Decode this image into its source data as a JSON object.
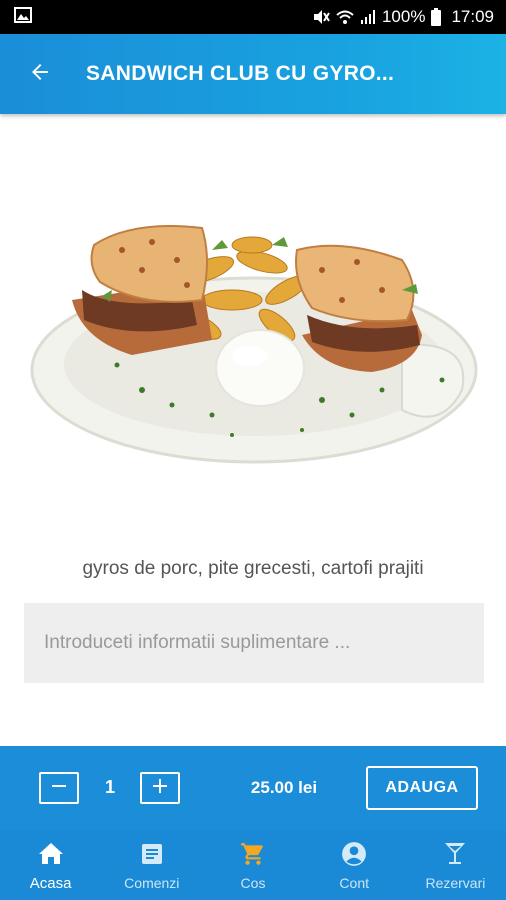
{
  "status_bar": {
    "battery": "100%",
    "time": "17:09"
  },
  "app_bar": {
    "title": "SANDWICH CLUB CU GYRO..."
  },
  "product": {
    "image_icon": "gyros-sandwich-plate",
    "description": "gyros de porc, pite grecesti, cartofi prajiti"
  },
  "notes": {
    "value": "",
    "placeholder": "Introduceti informatii suplimentare ..."
  },
  "order": {
    "minus_label": "−",
    "quantity": "1",
    "plus_label": "+",
    "price": "25.00 lei",
    "add_label": "ADAUGA"
  },
  "bottom_nav": {
    "items": [
      {
        "label": "Acasa",
        "icon": "home-icon",
        "active": true
      },
      {
        "label": "Comenzi",
        "icon": "orders-icon",
        "active": false
      },
      {
        "label": "Cos",
        "icon": "cart-icon",
        "active": false
      },
      {
        "label": "Cont",
        "icon": "account-icon",
        "active": false
      },
      {
        "label": "Rezervari",
        "icon": "cocktail-icon",
        "active": false
      }
    ]
  },
  "colors": {
    "primary": "#1c8dd8",
    "cart_accent": "#f5a623",
    "status_bar": "#000000"
  }
}
